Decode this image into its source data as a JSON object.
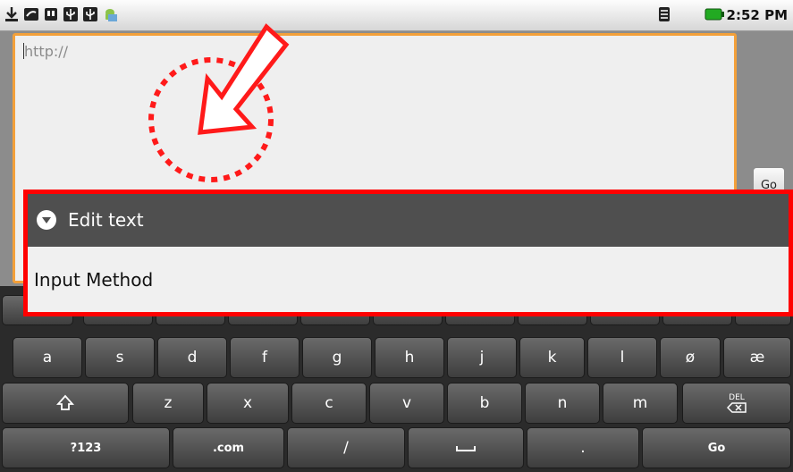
{
  "status_bar": {
    "icons": [
      "download-icon",
      "voicemail-icon",
      "sd-card-icon",
      "usb-icon",
      "usb-icon",
      "android-debug-icon"
    ],
    "right_icons": [
      "wifi-signal-icon",
      "battery-icon"
    ],
    "time": "2:52 PM"
  },
  "browser": {
    "url_placeholder": "http://",
    "go_label": "Go"
  },
  "dialog": {
    "title": "Edit text",
    "items": [
      "Input Method"
    ]
  },
  "keyboard": {
    "row2": [
      "a",
      "s",
      "d",
      "f",
      "g",
      "h",
      "j",
      "k",
      "l",
      "ø",
      "æ"
    ],
    "row3": [
      "z",
      "x",
      "c",
      "v",
      "b",
      "n",
      "m"
    ],
    "del_label": "DEL",
    "row4": [
      "?123",
      ".com",
      "/",
      "",
      ".",
      "Go"
    ]
  },
  "colors": {
    "accent_orange": "#f3a03a",
    "highlight_red": "#ff0000",
    "dialog_header": "#4f4f4f"
  }
}
